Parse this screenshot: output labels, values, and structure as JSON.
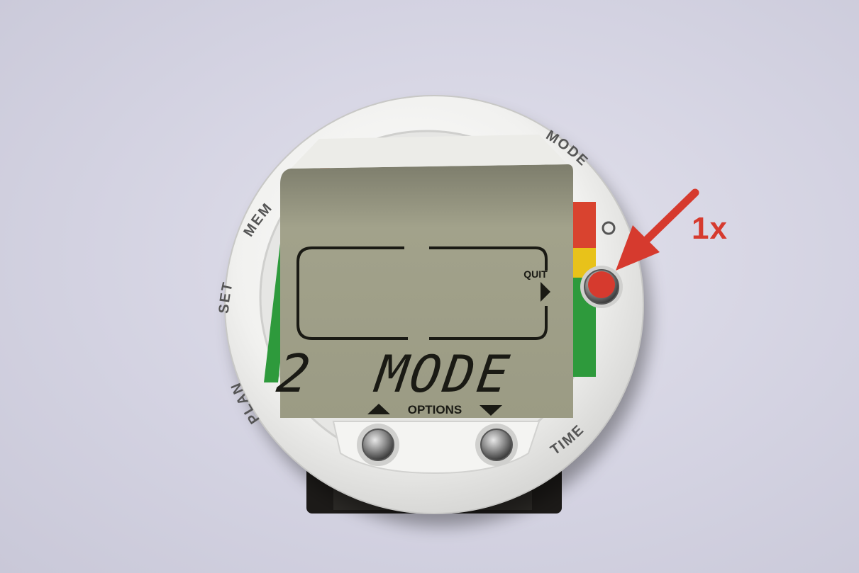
{
  "device": {
    "bezel_labels": {
      "mem": "MEM",
      "set": "SET",
      "plan": "PLAN",
      "mode": "MODE",
      "time": "TIME",
      "options": "OPTIONS"
    },
    "lcd": {
      "quit_label": "QUIT",
      "option_number": "2",
      "option_name": "MODE"
    }
  },
  "annotation": {
    "press_count": "1x",
    "highlight_color": "#d63a2e"
  },
  "colors": {
    "background": "#d4d3e2",
    "bezel": "#f3f3f1",
    "lcd": "#9a9a82",
    "scale_red": "#d9432f",
    "scale_yellow": "#e8c21a",
    "scale_green": "#2e9a3c"
  },
  "icons": [
    "mode-button-icon",
    "up-button-icon",
    "down-button-icon",
    "arrow-annotation-icon"
  ]
}
